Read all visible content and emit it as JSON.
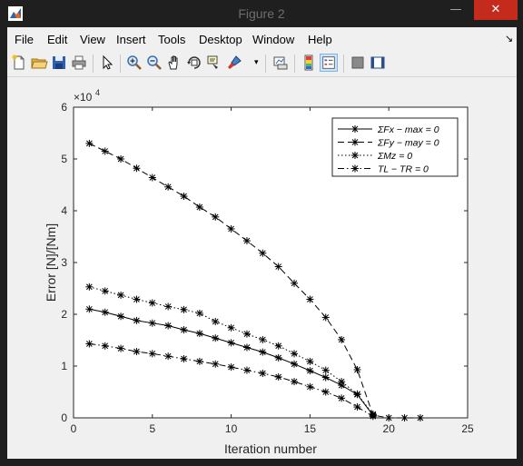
{
  "window": {
    "title": "Figure 2",
    "controls": [
      "—",
      "☐",
      "✕"
    ]
  },
  "menu": [
    "File",
    "Edit",
    "View",
    "Insert",
    "Tools",
    "Desktop",
    "Window",
    "Help"
  ],
  "toolbar_icons": [
    "new-figure-icon",
    "open-file-icon",
    "save-icon",
    "print-icon",
    "edit-plot-icon",
    "zoom-in-icon",
    "zoom-out-icon",
    "pan-icon",
    "rotate-3d-icon",
    "data-cursor-icon",
    "brush-icon",
    "link-plot-icon",
    "colorbar-icon",
    "legend-icon",
    "hide-plot-tools-icon",
    "show-plot-tools-icon"
  ],
  "chart_data": {
    "type": "line",
    "xlabel": "Iteration number",
    "ylabel": "Error [N]/[Nm]",
    "y_exponent_label": "×10",
    "y_exponent_power": "4",
    "xlim": [
      0,
      25
    ],
    "ylim": [
      0,
      60000
    ],
    "xticks": [
      0,
      5,
      10,
      15,
      20,
      25
    ],
    "yticks": [
      0,
      10000,
      20000,
      30000,
      40000,
      50000,
      60000
    ],
    "ytick_labels": [
      "0",
      "1",
      "2",
      "3",
      "4",
      "5",
      "6"
    ],
    "grid": false,
    "legend_position": "top-right",
    "marker": "asterisk",
    "color": "#000000",
    "series": [
      {
        "name": "ΣFx − max = 0",
        "style": "solid",
        "x": [
          1,
          2,
          3,
          4,
          5,
          6,
          7,
          8,
          9,
          10,
          11,
          12,
          13,
          14,
          15,
          16,
          17,
          18,
          19
        ],
        "y": [
          21000,
          20400,
          19600,
          18800,
          18300,
          17800,
          17000,
          16300,
          15400,
          14500,
          13600,
          12700,
          11600,
          10400,
          9100,
          7800,
          6300,
          4500,
          500
        ]
      },
      {
        "name": "ΣFy − may = 0",
        "style": "dashed",
        "x": [
          1,
          2,
          3,
          4,
          5,
          6,
          7,
          8,
          9,
          10,
          11,
          12,
          13,
          14,
          15,
          16,
          17,
          18,
          19,
          20,
          21,
          22
        ],
        "y": [
          53000,
          51500,
          50000,
          48200,
          46400,
          44600,
          42800,
          40700,
          38800,
          36500,
          34200,
          31800,
          29200,
          26000,
          22900,
          19400,
          15100,
          9300,
          500,
          0,
          0,
          0
        ]
      },
      {
        "name": "ΣMz = 0",
        "style": "dotted",
        "x": [
          1,
          2,
          3,
          4,
          5,
          6,
          7,
          8,
          9,
          10,
          11,
          12,
          13,
          14,
          15,
          16,
          17,
          18,
          19
        ],
        "y": [
          25300,
          24500,
          23700,
          22900,
          22200,
          21500,
          20900,
          20200,
          18600,
          17400,
          16200,
          15100,
          13900,
          12400,
          10900,
          9200,
          7000,
          4600,
          700
        ]
      },
      {
        "name": "TL − TR = 0",
        "style": "dashdot",
        "x": [
          1,
          2,
          3,
          4,
          5,
          6,
          7,
          8,
          9,
          10,
          11,
          12,
          13,
          14,
          15,
          16,
          17,
          18,
          19
        ],
        "y": [
          14300,
          13900,
          13400,
          12800,
          12400,
          11900,
          11400,
          10900,
          10400,
          9800,
          9200,
          8600,
          7900,
          7000,
          6000,
          5000,
          3800,
          2100,
          300
        ]
      }
    ]
  }
}
